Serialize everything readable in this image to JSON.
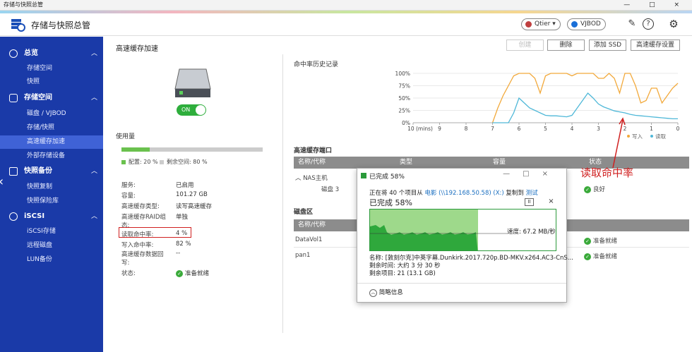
{
  "window": {
    "title": "存储与快照总管",
    "controls": "— □ ×"
  },
  "header": {
    "app_title": "存储与快照总管",
    "qtier_label": "Qtier",
    "vjbod_label": "VJBOD",
    "icons": [
      "search-settings-icon",
      "help-icon",
      "gear-icon"
    ]
  },
  "sidebar": {
    "sections": [
      {
        "label": "总览",
        "items": [
          "存储空间",
          "快照"
        ]
      },
      {
        "label": "存储空间",
        "items": [
          "磁盘 / VJBOD",
          "存储/快照",
          "高速缓存加速",
          "外部存储设备"
        ]
      },
      {
        "label": "快照备份",
        "items": [
          "快照复制",
          "快照保险库"
        ]
      },
      {
        "label": "iSCSI",
        "items": [
          "iSCSI存储",
          "远程磁盘",
          "LUN备份"
        ]
      }
    ],
    "active_item": "高速缓存加速"
  },
  "main": {
    "title": "高速缓存加速",
    "buttons": {
      "create": "创建",
      "delete": "删除",
      "add_ssd": "添加 SSD",
      "cache_settings": "高速缓存设置"
    },
    "toggle_label": "ON",
    "usage": {
      "title": "使用量",
      "configured_pct": 20,
      "legend_configured": "配置: 20 %",
      "legend_free": "剩余空间: 80 %"
    },
    "info": [
      {
        "label": "服务:",
        "value": "已启用"
      },
      {
        "label": "容量:",
        "value": "101.27 GB"
      },
      {
        "label": "高速缓存类型:",
        "value": "读写高速缓存"
      },
      {
        "label": "高速缓存RAID组态:",
        "value": "单独"
      },
      {
        "label": "读取命中率:",
        "value": "4 %"
      },
      {
        "label": "写入命中率:",
        "value": "82 %"
      },
      {
        "label": "高速缓存数据回写:",
        "value": "--"
      },
      {
        "label": "状态:",
        "value": "准备就绪"
      }
    ],
    "cache_port": {
      "title": "高速缓存端口",
      "columns": [
        "名称/代称",
        "类型",
        "容量",
        "状态"
      ],
      "group": "NAS主机",
      "row": {
        "name": "磁盘 3",
        "status": "良好"
      }
    },
    "volumes": {
      "title": "磁盘区",
      "columns": [
        "名称/代称"
      ],
      "rows": [
        {
          "name": "DataVol1",
          "status": "准备就绪"
        },
        {
          "name": "pan1",
          "status": "准备就绪"
        }
      ]
    },
    "annotation": "读取命中率"
  },
  "chart_data": {
    "type": "line",
    "title": "命中率历史记录",
    "xlabel": "",
    "ylabel": "",
    "x": [
      10,
      9,
      8,
      7,
      6.8,
      6.6,
      6.4,
      6.2,
      6,
      5.8,
      5.6,
      5.4,
      5.2,
      5,
      4.8,
      4.6,
      4.4,
      4.2,
      4,
      3.8,
      3.6,
      3.4,
      3.2,
      3,
      2.8,
      2.6,
      2.4,
      2.2,
      2,
      1.8,
      1.6,
      1.4,
      1.2,
      1,
      0.8,
      0.6,
      0.4,
      0.2,
      0
    ],
    "x_tick_labels": [
      "10 (mins)",
      "9",
      "8",
      "7",
      "6",
      "5",
      "4",
      "3",
      "2",
      "1",
      "0"
    ],
    "y_tick_labels": [
      "0%",
      "25%",
      "50%",
      "75%",
      "100%"
    ],
    "xlim": [
      10,
      0
    ],
    "ylim": [
      0,
      100
    ],
    "series": [
      {
        "name": "写入",
        "color": "#f2a93b",
        "values": [
          null,
          null,
          null,
          0,
          30,
          55,
          75,
          95,
          100,
          100,
          100,
          90,
          60,
          95,
          100,
          100,
          100,
          100,
          95,
          100,
          100,
          100,
          100,
          90,
          90,
          100,
          90,
          60,
          100,
          100,
          75,
          40,
          45,
          70,
          70,
          40,
          55,
          70,
          80
        ]
      },
      {
        "name": "读取",
        "color": "#4fb8d8",
        "values": [
          null,
          null,
          null,
          0,
          0,
          0,
          0,
          20,
          50,
          40,
          30,
          25,
          20,
          15,
          14,
          14,
          13,
          12,
          15,
          30,
          45,
          60,
          50,
          38,
          32,
          28,
          24,
          22,
          20,
          17,
          15,
          14,
          13,
          12,
          11,
          10,
          9,
          8,
          8
        ]
      }
    ]
  },
  "dialog": {
    "title": "已完成 58%",
    "line1_prefix": "正在将 40 个项目从 ",
    "source": "电影 (\\\\192.168.50.58) (X:)",
    "line1_mid": " 复制到 ",
    "dest": "测试",
    "percent_label": "已完成 58%",
    "progress_pct": 58,
    "pause_icon": "II",
    "close_icon": "×",
    "speed": "速度: 67.2 MB/秒",
    "name_line": "名称: [敦刻尔克]中英字幕.Dunkirk.2017.720p.BD-MKV.x264.AC3-CnS...",
    "time_line": "剩余时间: 大约 3 分 30 秒",
    "items_line": "剩余项目: 21 (13.1 GB)",
    "brief_label": "简略信息"
  }
}
